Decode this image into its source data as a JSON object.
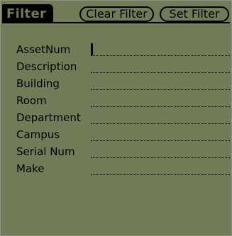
{
  "header": {
    "title": "Filter",
    "clear_button": "Clear Filter",
    "set_button": "Set Filter"
  },
  "form": {
    "fields": [
      {
        "label": "AssetNum",
        "value": ""
      },
      {
        "label": "Description",
        "value": ""
      },
      {
        "label": "Building",
        "value": ""
      },
      {
        "label": "Room",
        "value": ""
      },
      {
        "label": "Department",
        "value": ""
      },
      {
        "label": "Campus",
        "value": ""
      },
      {
        "label": "Serial Num",
        "value": ""
      },
      {
        "label": "Make",
        "value": ""
      }
    ]
  },
  "colors": {
    "screen_background": "#717b57",
    "foreground": "#000000"
  }
}
